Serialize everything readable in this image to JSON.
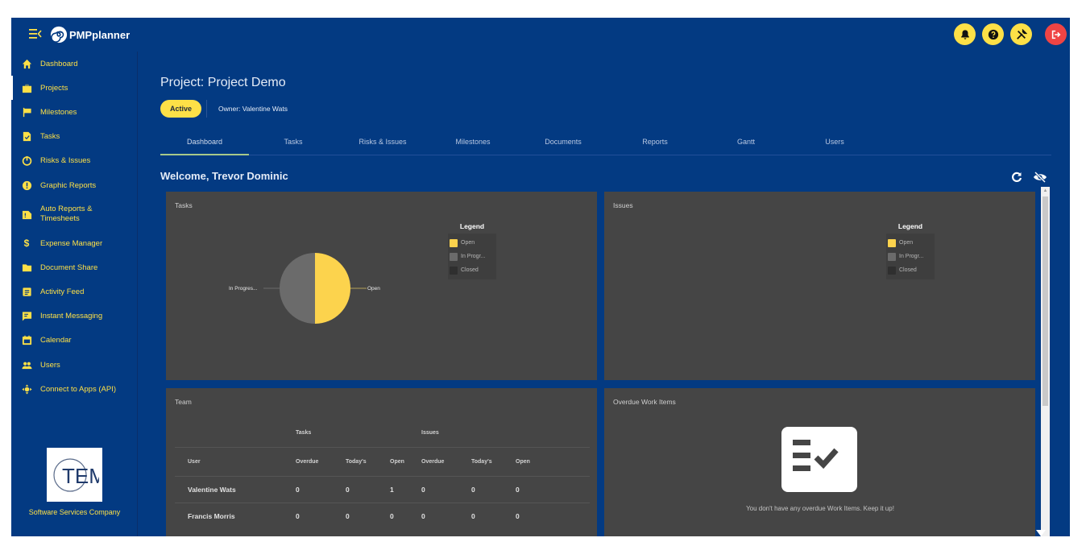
{
  "app": {
    "brand": "PMPplanner",
    "colors": {
      "primary": "#033a82",
      "accent": "#fde047",
      "danger": "#ef4444",
      "card": "#454545"
    }
  },
  "topbar": {
    "actions": [
      {
        "name": "notifications",
        "icon": "bell-icon"
      },
      {
        "name": "help",
        "icon": "question-icon"
      },
      {
        "name": "tools",
        "icon": "tools-icon"
      },
      {
        "name": "logout",
        "icon": "logout-icon"
      }
    ]
  },
  "sidebar": {
    "items": [
      {
        "label": "Dashboard",
        "icon": "home-icon"
      },
      {
        "label": "Projects",
        "icon": "briefcase-icon",
        "active": true
      },
      {
        "label": "Milestones",
        "icon": "flag-icon"
      },
      {
        "label": "Tasks",
        "icon": "task-file-icon"
      },
      {
        "label": "Risks & Issues",
        "icon": "power-icon"
      },
      {
        "label": "Graphic Reports",
        "icon": "alert-circle-icon"
      },
      {
        "label": "Auto Reports & Timesheets",
        "icon": "report-file-icon"
      },
      {
        "label": "Expense Manager",
        "icon": "dollar-icon"
      },
      {
        "label": "Document Share",
        "icon": "folder-icon"
      },
      {
        "label": "Activity Feed",
        "icon": "feed-icon"
      },
      {
        "label": "Instant Messaging",
        "icon": "chat-icon"
      },
      {
        "label": "Calendar",
        "icon": "calendar-icon"
      },
      {
        "label": "Users",
        "icon": "users-icon"
      },
      {
        "label": "Connect to Apps (API)",
        "icon": "api-icon"
      }
    ],
    "company_logo_text": "TEMS",
    "company_name": "Software Services Company"
  },
  "project": {
    "title": "Project: Project Demo",
    "status": "Active",
    "owner": "Owner: Valentine Wats"
  },
  "tabs": [
    {
      "label": "Dashboard",
      "active": true
    },
    {
      "label": "Tasks"
    },
    {
      "label": "Risks & Issues"
    },
    {
      "label": "Milestones"
    },
    {
      "label": "Documents"
    },
    {
      "label": "Reports"
    },
    {
      "label": "Gantt"
    },
    {
      "label": "Users"
    }
  ],
  "welcome": "Welcome, Trevor Dominic",
  "cards": {
    "tasks": {
      "title": "Tasks"
    },
    "issues": {
      "title": "Issues"
    },
    "team": {
      "title": "Team"
    },
    "overdue": {
      "title": "Overdue Work Items",
      "empty_message": "You don't have any overdue Work Items. Keep it up!"
    }
  },
  "chart_data": [
    {
      "type": "pie",
      "title": "Tasks",
      "legend_title": "Legend",
      "legend_position": "top-right",
      "categories": [
        "Open",
        "In Progr...",
        "Closed"
      ],
      "values": [
        1,
        1,
        0
      ],
      "colors": [
        "#fcd34d",
        "#6b6b6b",
        "#2f2f2f"
      ],
      "slice_labels": [
        "Open",
        "In Progres..."
      ]
    },
    {
      "type": "pie",
      "title": "Issues",
      "legend_title": "Legend",
      "legend_position": "top-right",
      "categories": [
        "Open",
        "In Progr...",
        "Closed"
      ],
      "values": [
        0,
        0,
        0
      ],
      "colors": [
        "#fcd34d",
        "#6b6b6b",
        "#2f2f2f"
      ]
    }
  ],
  "team_table": {
    "groups": [
      "Tasks",
      "Issues"
    ],
    "columns": [
      "User",
      "Overdue",
      "Today's",
      "Open",
      "Overdue",
      "Today's",
      "Open"
    ],
    "rows": [
      [
        "Valentine Wats",
        "0",
        "0",
        "1",
        "0",
        "0",
        "0"
      ],
      [
        "Francis Morris",
        "0",
        "0",
        "0",
        "0",
        "0",
        "0"
      ]
    ]
  }
}
